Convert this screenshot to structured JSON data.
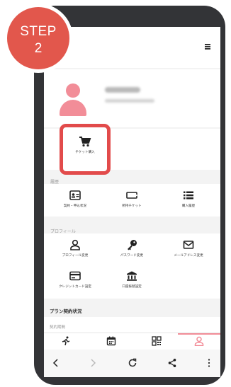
{
  "step_badge": {
    "line1": "STEP",
    "line2": "2"
  },
  "colors": {
    "accent": "#e2574c",
    "avatar": "#f28d98",
    "highlight": "#e24b4b"
  },
  "header": {
    "menu_icon": "hamburger-icon"
  },
  "shortcut": {
    "item": {
      "label": "チケット購入",
      "icon": "cart-icon"
    }
  },
  "history": {
    "section_label": "履歴",
    "items": [
      {
        "label": "契約・申込状況",
        "icon": "contract-card-icon"
      },
      {
        "label": "所持チケット",
        "icon": "ticket-icon"
      },
      {
        "label": "購入履歴",
        "icon": "list-icon"
      }
    ]
  },
  "profile_section": {
    "section_label": "プロフィール",
    "items": [
      {
        "label": "プロフィール変更",
        "icon": "person-icon"
      },
      {
        "label": "パスワード変更",
        "icon": "key-icon"
      },
      {
        "label": "メールアドレス変更",
        "icon": "mail-icon"
      },
      {
        "label": "クレジットカード設定",
        "icon": "credit-card-icon"
      },
      {
        "label": "口座振替設定",
        "icon": "bank-icon"
      }
    ]
  },
  "plan": {
    "title": "プラン契約状況",
    "period_label": "契約期間"
  },
  "tabbar": {
    "tabs": [
      "run-icon",
      "calendar-icon",
      "qr-icon",
      "person-icon"
    ],
    "active_index": 3
  },
  "navbar": {
    "items": [
      "back-icon",
      "forward-icon",
      "reload-icon",
      "share-icon",
      "more-icon"
    ]
  }
}
